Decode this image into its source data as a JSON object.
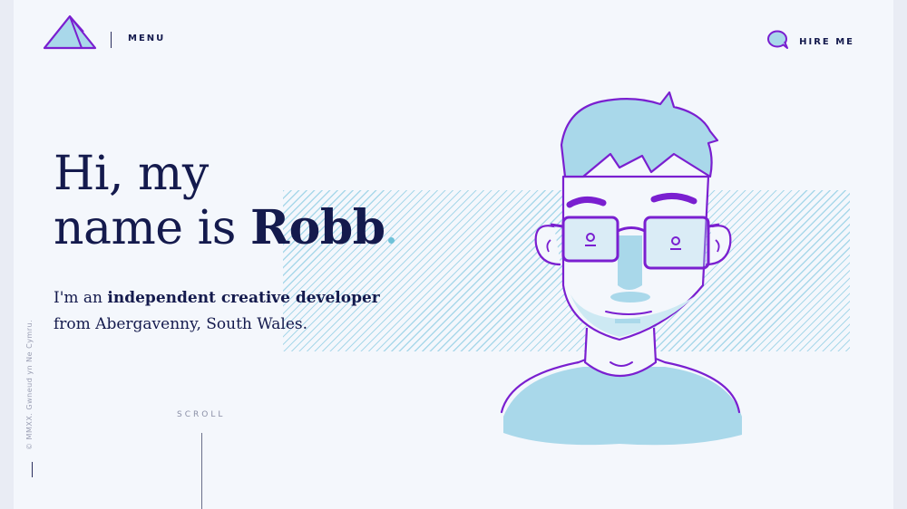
{
  "nav": {
    "logo_icon": "triangle-logo-icon",
    "menu_label": "MENU",
    "hire_label": "HIRE ME",
    "hire_icon": "speech-bubble-icon"
  },
  "hero": {
    "line1": "Hi, my",
    "line2_prefix": "name is ",
    "name": "Robb",
    "intro_prefix": "I'm an ",
    "intro_strong": "independent creative developer",
    "intro_line2": "from Abergavenny, South Wales."
  },
  "scroll_label": "SCROLL",
  "side_note": "© MMXX. Gwneud yn Ne Cymru.",
  "colors": {
    "ink": "#141a4d",
    "purple": "#7a1fd0",
    "light_blue": "#a9d8ea",
    "accent_dot": "#6fc1d8",
    "background": "#f4f7fc"
  }
}
